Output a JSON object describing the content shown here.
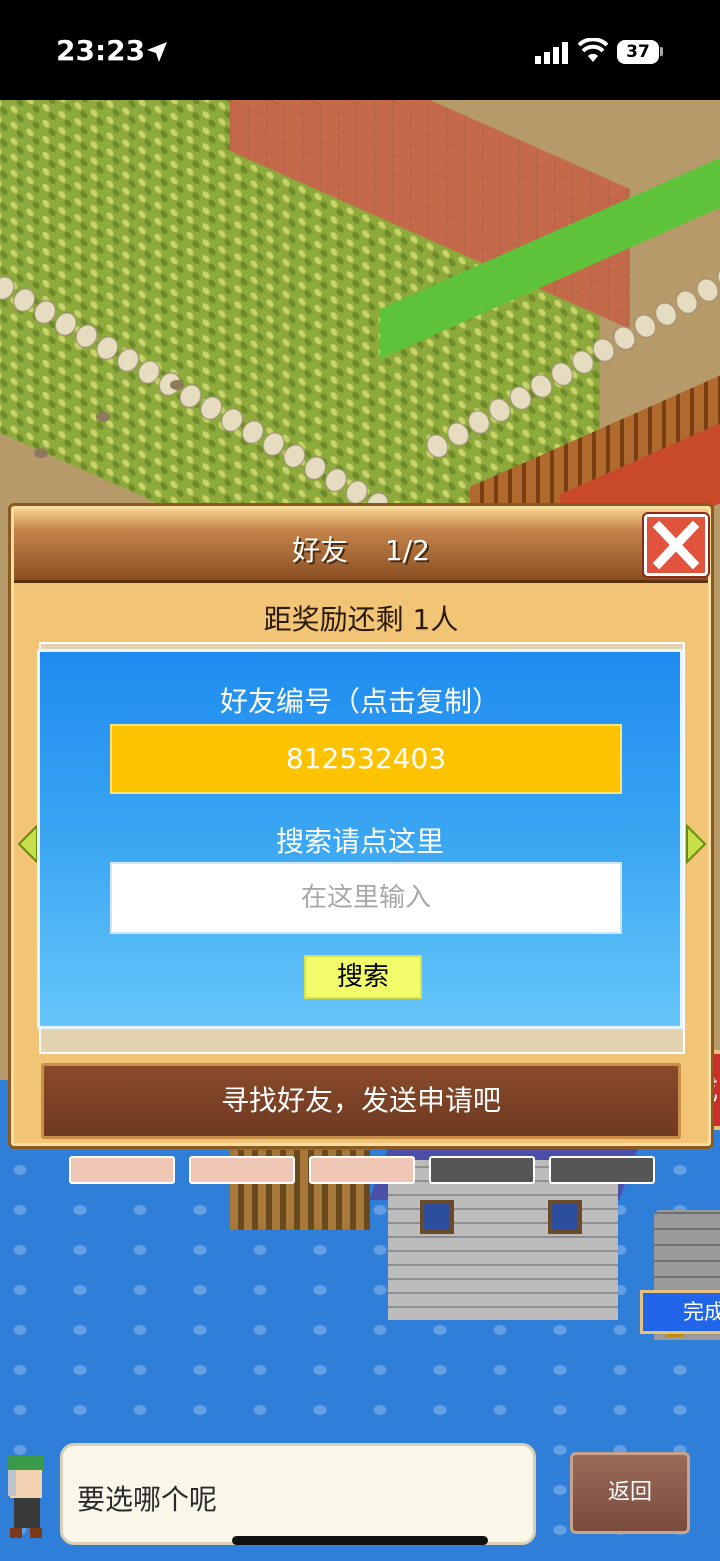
{
  "status_bar": {
    "time": "23:23",
    "battery": "37",
    "icons": [
      "location-arrow-icon",
      "signal-icon",
      "wifi-icon",
      "battery-icon"
    ]
  },
  "dialog": {
    "title": "好友　 1/2",
    "reward_text": "距奖励还剩 1人",
    "find_friend_button": "寻找好友，发送申请吧"
  },
  "friend_panel": {
    "id_label": "好友编号（点击复制）",
    "id_value": "812532403",
    "search_label": "搜索请点这里",
    "search_placeholder": "在这里输入",
    "search_button": "搜索"
  },
  "side_panels": {
    "right_red_label": "成",
    "right_blue_label": "完成"
  },
  "bottom_bar": {
    "chat_text": "要选哪个呢",
    "back_button": "返回"
  },
  "colors": {
    "dialog_bg": "#f2c576",
    "panel_blue": "#1f8bf0",
    "id_yellow": "#fec300",
    "search_button_bg": "#f2fb6a",
    "close_red": "#e2533e",
    "find_button_brown": "#6e3a22"
  }
}
